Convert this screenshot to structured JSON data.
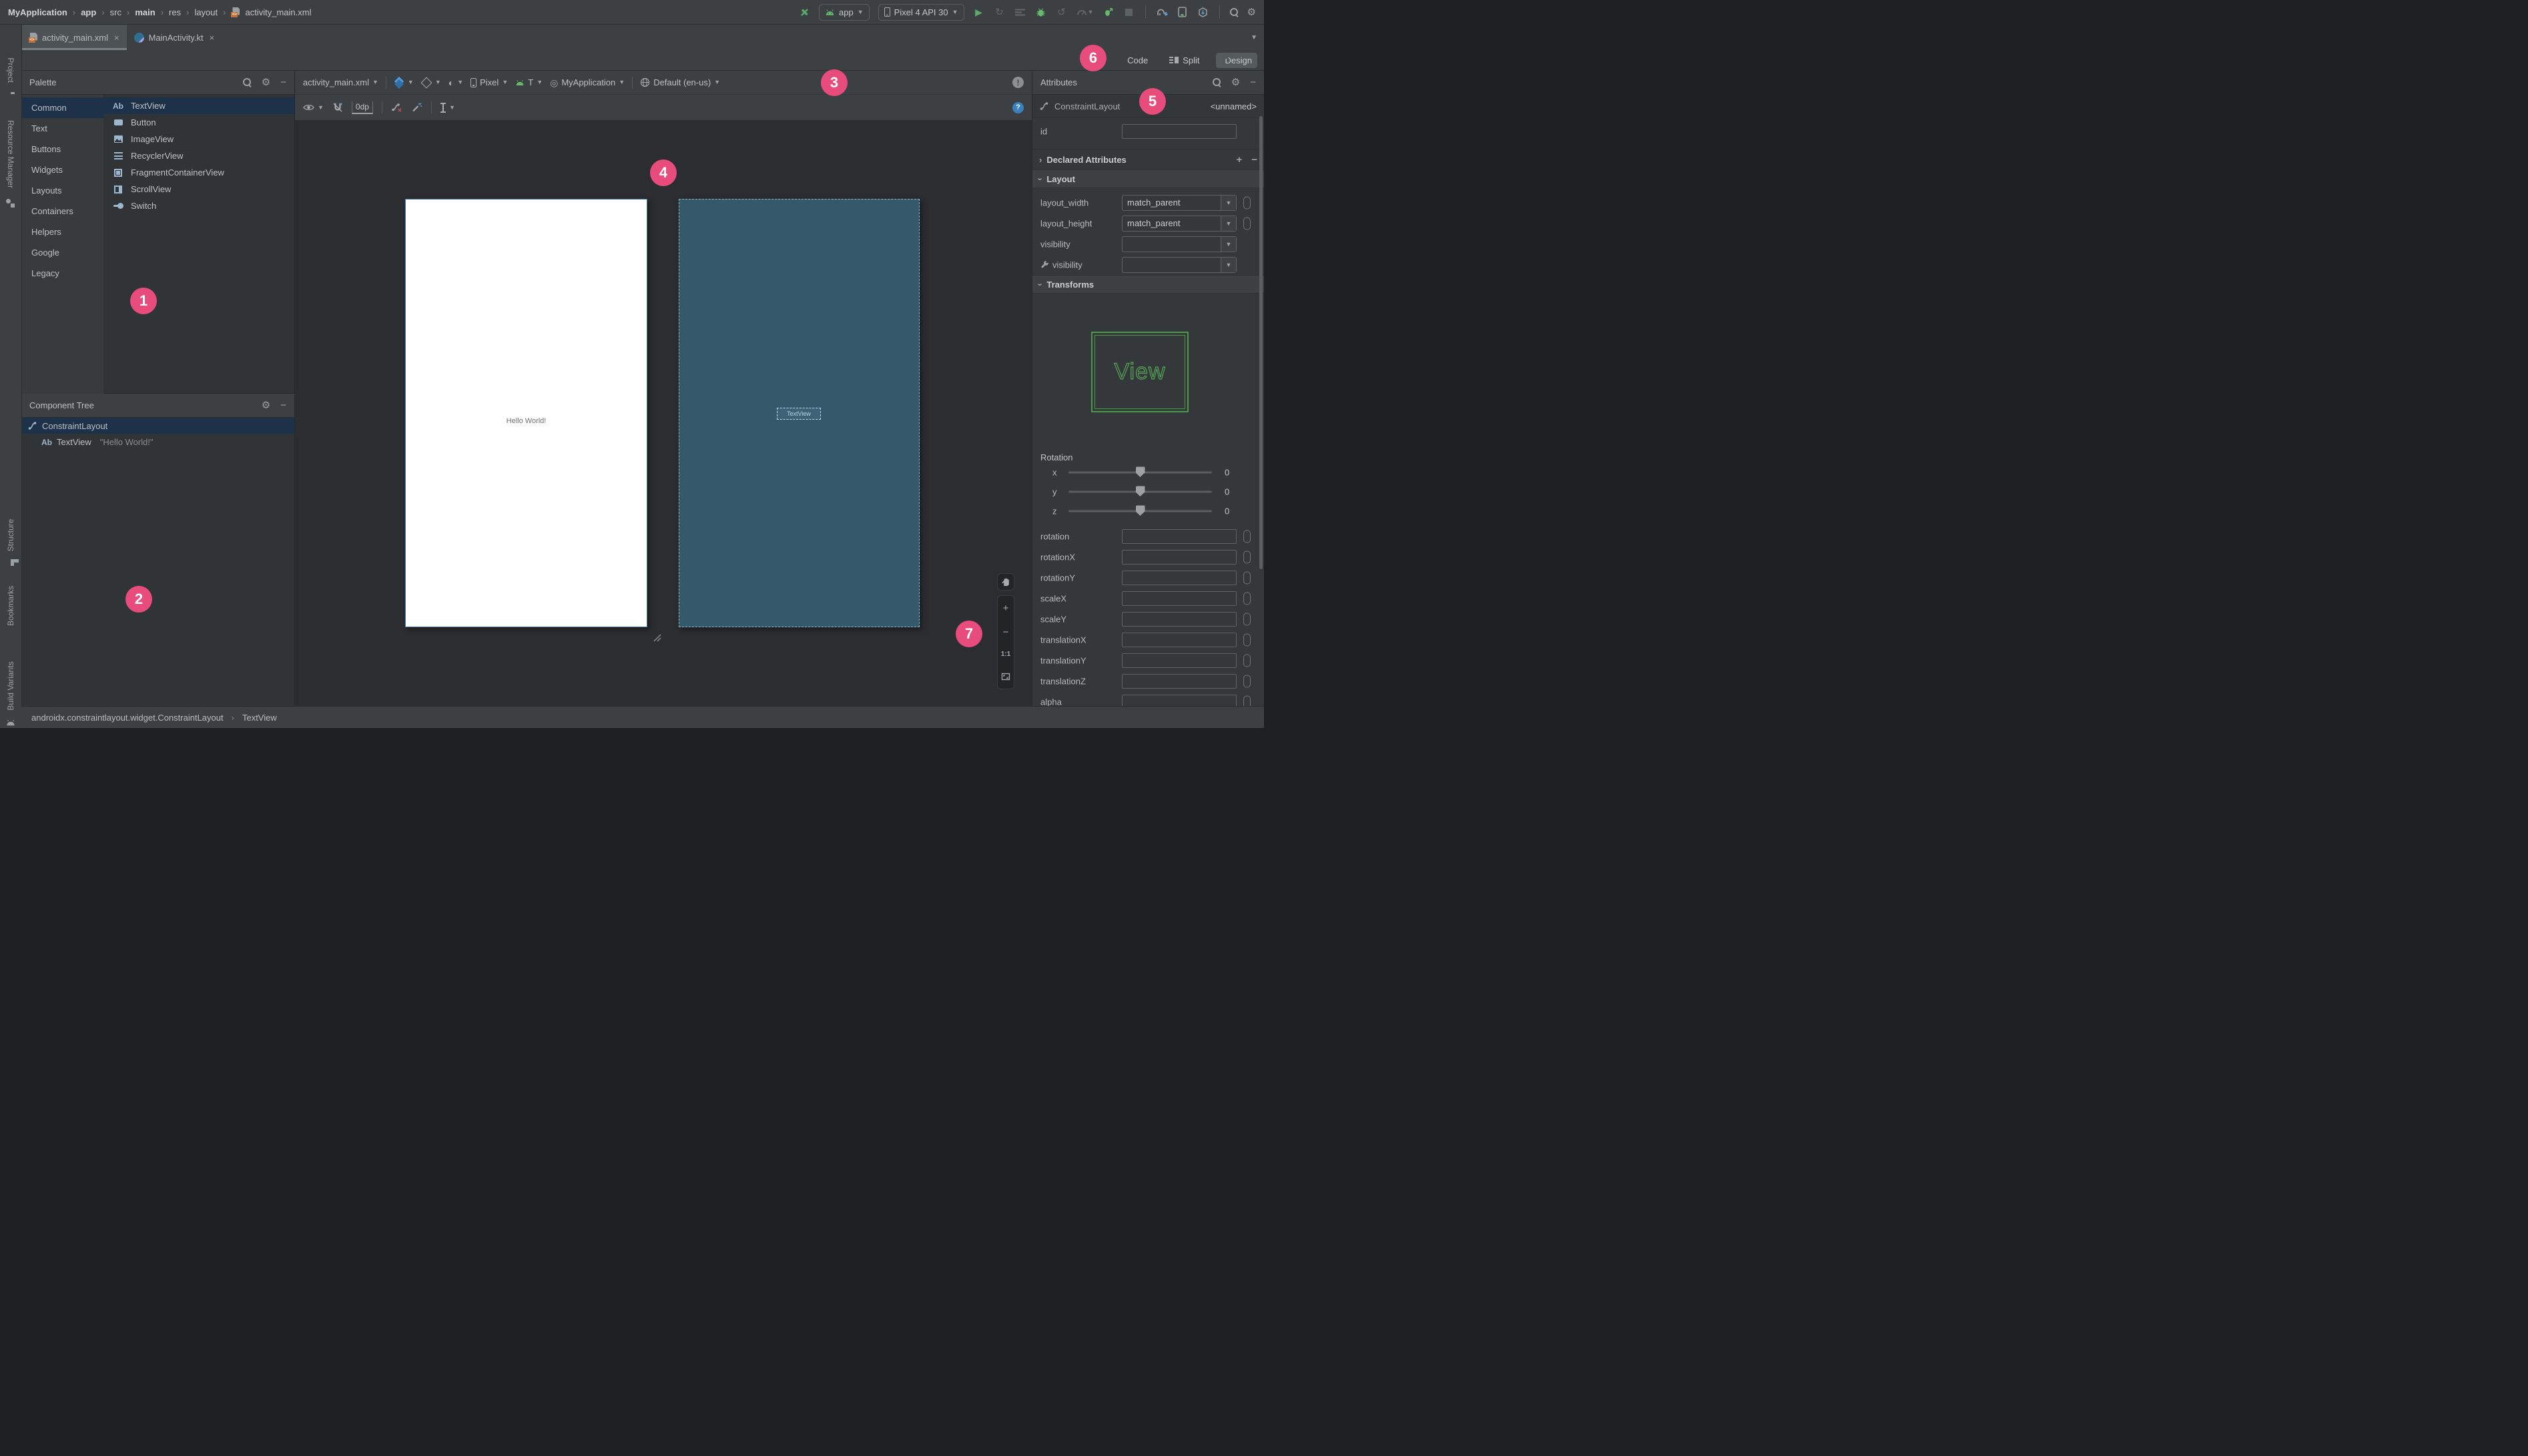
{
  "window": {
    "breadcrumbs": [
      "MyApplication",
      "app",
      "src",
      "main",
      "res",
      "layout",
      "activity_main.xml"
    ],
    "run_config": "app",
    "device": "Pixel 4 API 30"
  },
  "tabs": [
    {
      "label": "activity_main.xml",
      "active": true
    },
    {
      "label": "MainActivity.kt",
      "active": false
    }
  ],
  "view_modes": [
    {
      "label": "Code",
      "active": false
    },
    {
      "label": "Split",
      "active": false
    },
    {
      "label": "Design",
      "active": true
    }
  ],
  "left_stripe": {
    "top": [
      "Project",
      "Resource Manager"
    ],
    "bottom": [
      "Structure",
      "Bookmarks",
      "Build Variants"
    ]
  },
  "palette": {
    "title": "Palette",
    "categories": [
      "Common",
      "Text",
      "Buttons",
      "Widgets",
      "Layouts",
      "Containers",
      "Helpers",
      "Google",
      "Legacy"
    ],
    "selected_category": "Common",
    "components": [
      "TextView",
      "Button",
      "ImageView",
      "RecyclerView",
      "FragmentContainerView",
      "ScrollView",
      "Switch"
    ],
    "selected_component": "TextView"
  },
  "component_tree": {
    "title": "Component Tree",
    "nodes": [
      {
        "label": "ConstraintLayout",
        "detail": "",
        "selected": true,
        "depth": 0
      },
      {
        "label": "TextView",
        "detail": "\"Hello World!\"",
        "selected": false,
        "depth": 1
      }
    ]
  },
  "design_toolbar": {
    "file": "activity_main.xml",
    "device": "Pixel",
    "api_level": "T",
    "theme": "MyApplication",
    "locale": "Default (en-us)",
    "default_margin": "0dp",
    "warning_badge": "!",
    "help_badge": "?"
  },
  "design_surface": {
    "design_text": "Hello World!",
    "blueprint_text": "TextView"
  },
  "zoom_controls": {
    "zoom_in": "+",
    "zoom_out": "−",
    "zoom_100": "1:1"
  },
  "attributes": {
    "title": "Attributes",
    "component_type": "ConstraintLayout",
    "component_id": "<unnamed>",
    "id_label": "id",
    "id_value": "",
    "sections": {
      "declared": "Declared Attributes",
      "layout": "Layout",
      "transforms": "Transforms"
    },
    "layout_rows": [
      {
        "label": "layout_width",
        "value": "match_parent",
        "pill": true,
        "wrench": false
      },
      {
        "label": "layout_height",
        "value": "match_parent",
        "pill": true,
        "wrench": false
      },
      {
        "label": "visibility",
        "value": "",
        "pill": false,
        "wrench": false
      },
      {
        "label": "visibility",
        "value": "",
        "pill": false,
        "wrench": true
      }
    ],
    "view_preview_label": "View",
    "rotation": {
      "title": "Rotation",
      "sliders": [
        {
          "axis": "x",
          "value": "0"
        },
        {
          "axis": "y",
          "value": "0"
        },
        {
          "axis": "z",
          "value": "0"
        }
      ]
    },
    "transform_fields": [
      "rotation",
      "rotationX",
      "rotationY",
      "scaleX",
      "scaleY",
      "translationX",
      "translationY",
      "translationZ",
      "alpha"
    ]
  },
  "status_bar": {
    "segments": [
      "androidx.constraintlayout.widget.ConstraintLayout",
      "TextView"
    ]
  },
  "annotations": [
    "1",
    "2",
    "3",
    "4",
    "5",
    "6",
    "7"
  ],
  "colors": {
    "accent_pink": "#e84c7c",
    "selection_blue": "#1d3148",
    "android_green": "#67bb6a",
    "blueprint_teal": "#33596b",
    "icon_blue": "#4f9bdd",
    "help_blue": "#3a82be",
    "view_green": "#4a9a4a"
  }
}
